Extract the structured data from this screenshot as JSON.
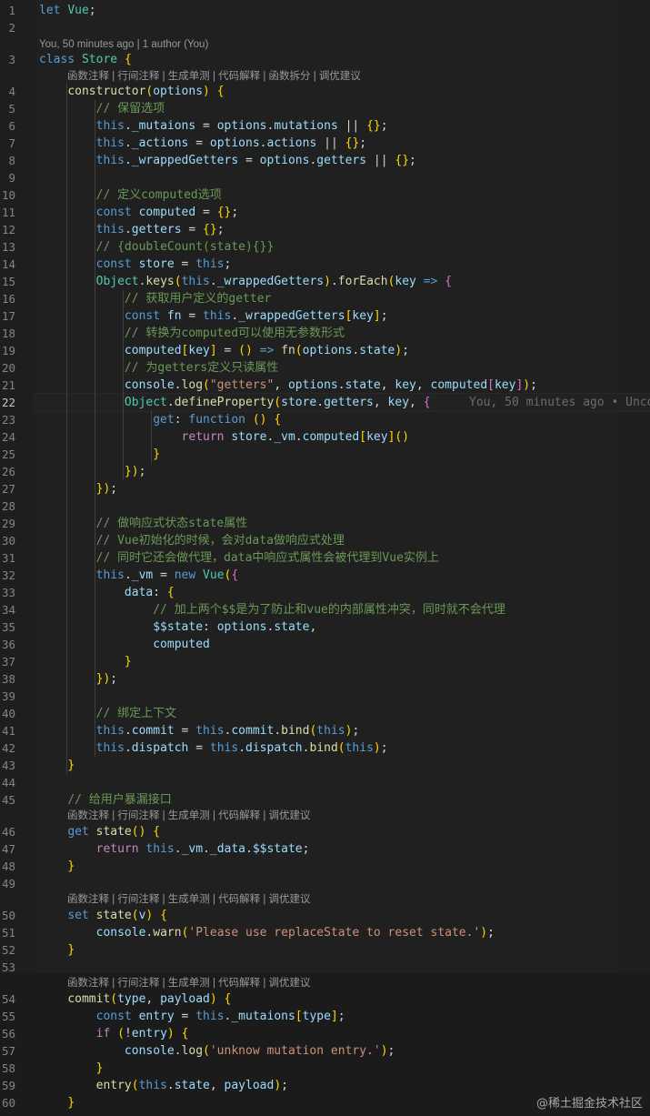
{
  "header": {
    "blame_top": "You, 50 minutes ago | 1 author (You)",
    "blame_line22": "You, 50 minutes ago • Unco"
  },
  "codelens": {
    "full": "函数注释 | 行间注释 | 生成单测 | 代码解释 | 函数拆分 | 调优建议",
    "short": "函数注释 | 行间注释 | 生成单测 | 代码解释 | 调优建议"
  },
  "active_line": "22",
  "code_lines": [
    {
      "n": "1",
      "t": "let Vue;"
    },
    {
      "n": "2",
      "t": ""
    },
    {
      "n": "3",
      "t": "class Store {"
    },
    {
      "n": "4",
      "t": "    constructor(options) {"
    },
    {
      "n": "5",
      "t": "        // 保留选项"
    },
    {
      "n": "6",
      "t": "        this._mutaions = options.mutations || {};"
    },
    {
      "n": "7",
      "t": "        this._actions = options.actions || {};"
    },
    {
      "n": "8",
      "t": "        this._wrappedGetters = options.getters || {};"
    },
    {
      "n": "9",
      "t": ""
    },
    {
      "n": "10",
      "t": "        // 定义computed选项"
    },
    {
      "n": "11",
      "t": "        const computed = {};"
    },
    {
      "n": "12",
      "t": "        this.getters = {};"
    },
    {
      "n": "13",
      "t": "        // {doubleCount(state){}}"
    },
    {
      "n": "14",
      "t": "        const store = this;"
    },
    {
      "n": "15",
      "t": "        Object.keys(this._wrappedGetters).forEach(key => {"
    },
    {
      "n": "16",
      "t": "            // 获取用户定义的getter"
    },
    {
      "n": "17",
      "t": "            const fn = this._wrappedGetters[key];"
    },
    {
      "n": "18",
      "t": "            // 转换为computed可以使用无参数形式"
    },
    {
      "n": "19",
      "t": "            computed[key] = () => fn(options.state);"
    },
    {
      "n": "20",
      "t": "            // 为getters定义只读属性"
    },
    {
      "n": "21",
      "t": "            console.log(\"getters\", options.state, key, computed[key]);"
    },
    {
      "n": "22",
      "t": "            Object.defineProperty(store.getters, key, {"
    },
    {
      "n": "23",
      "t": "                get: function () {"
    },
    {
      "n": "24",
      "t": "                    return store._vm.computed[key]()"
    },
    {
      "n": "25",
      "t": "                }"
    },
    {
      "n": "26",
      "t": "            });"
    },
    {
      "n": "27",
      "t": "        });"
    },
    {
      "n": "28",
      "t": ""
    },
    {
      "n": "29",
      "t": "        // 做响应式状态state属性"
    },
    {
      "n": "30",
      "t": "        // Vue初始化的时候，会对data做响应式处理"
    },
    {
      "n": "31",
      "t": "        // 同时它还会做代理，data中响应式属性会被代理到Vue实例上"
    },
    {
      "n": "32",
      "t": "        this._vm = new Vue({"
    },
    {
      "n": "33",
      "t": "            data: {"
    },
    {
      "n": "34",
      "t": "                // 加上两个$$是为了防止和vue的内部属性冲突，同时就不会代理"
    },
    {
      "n": "35",
      "t": "                $$state: options.state,"
    },
    {
      "n": "36",
      "t": "                computed"
    },
    {
      "n": "37",
      "t": "            }"
    },
    {
      "n": "38",
      "t": "        });"
    },
    {
      "n": "39",
      "t": ""
    },
    {
      "n": "40",
      "t": "        // 绑定上下文"
    },
    {
      "n": "41",
      "t": "        this.commit = this.commit.bind(this);"
    },
    {
      "n": "42",
      "t": "        this.dispatch = this.dispatch.bind(this);"
    },
    {
      "n": "43",
      "t": "    }"
    },
    {
      "n": "44",
      "t": ""
    },
    {
      "n": "45",
      "t": "    // 给用户暴漏接口"
    },
    {
      "n": "46",
      "t": "    get state() {"
    },
    {
      "n": "47",
      "t": "        return this._vm._data.$$state;"
    },
    {
      "n": "48",
      "t": "    }"
    },
    {
      "n": "49",
      "t": ""
    },
    {
      "n": "50",
      "t": "    set state(v) {"
    },
    {
      "n": "51",
      "t": "        console.warn('Please use replaceState to reset state.');"
    },
    {
      "n": "52",
      "t": "    }"
    },
    {
      "n": "53",
      "t": ""
    },
    {
      "n": "54",
      "t": "    commit(type, payload) {"
    },
    {
      "n": "55",
      "t": "        const entry = this._mutaions[type];"
    },
    {
      "n": "56",
      "t": "        if (!entry) {"
    },
    {
      "n": "57",
      "t": "            console.log('unknow mutation entry.');"
    },
    {
      "n": "58",
      "t": "        }"
    },
    {
      "n": "59",
      "t": "        entry(this.state, payload);"
    },
    {
      "n": "60",
      "t": "    }"
    }
  ],
  "watermark": "@稀土掘金技术社区",
  "colors": {
    "background": "#1e1e1e",
    "keyword": "#569cd6",
    "control": "#c586c0",
    "class": "#4ec9b0",
    "function": "#dcdcaa",
    "variable": "#9cdcfe",
    "string": "#ce9178",
    "comment": "#6a9955"
  }
}
